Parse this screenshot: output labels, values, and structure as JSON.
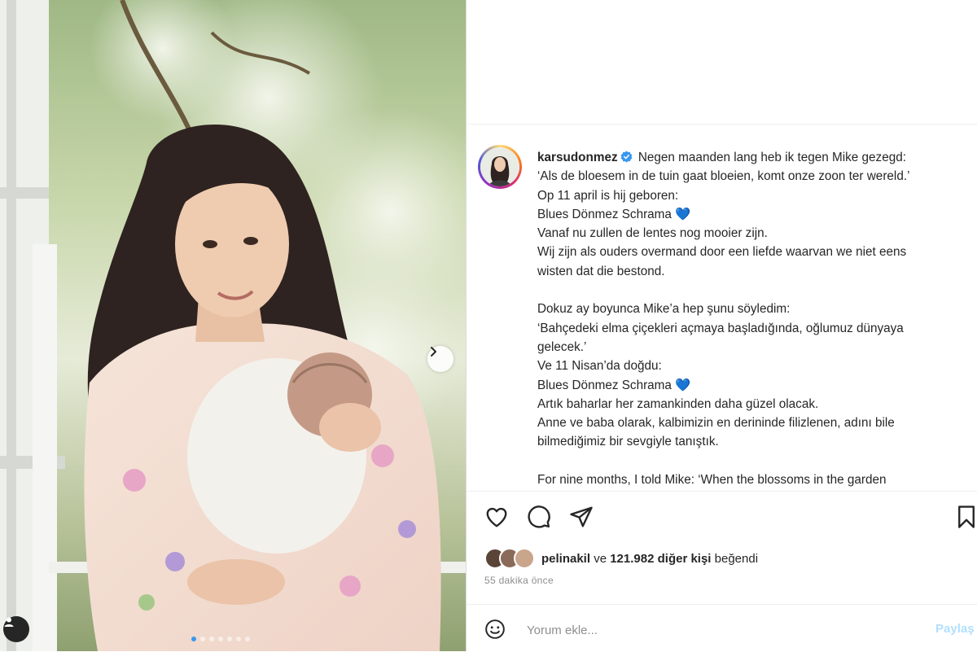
{
  "post": {
    "username": "karsudonmez",
    "caption_lines": [
      "Negen maanden lang heb ik tegen Mike gezegd:",
      "‘Als de bloesem in de tuin gaat bloeien, komt onze zoon ter wereld.’",
      "Op 11 april is hij geboren:",
      "Blues Dönmez Schrama 💙",
      "Vanaf nu zullen de lentes nog mooier zijn.",
      "Wij zijn als ouders overmand door een liefde waarvan we niet eens",
      "wisten dat die bestond.",
      "",
      "Dokuz ay boyunca Mike’a hep şunu söyledim:",
      "‘Bahçedeki elma çiçekleri açmaya başladığında, oğlumuz dünyaya",
      "gelecek.’",
      "Ve 11 Nisan’da doğdu:",
      "Blues Dönmez Schrama 💙",
      "Artık baharlar her zamankinden daha güzel olacak.",
      "Anne ve baba olarak, kalbimizin en derininde filizlenen, adını bile",
      "bilmediğimiz bir sevgiyle tanıştık.",
      "",
      "For nine months, I told Mike: ‘When the blossoms in the garden"
    ]
  },
  "likes": {
    "liker": "pelinakil",
    "connector": "ve",
    "others": "121.982 diğer kişi",
    "suffix": "beğendi"
  },
  "time_ago": "55 dakika önce",
  "comment": {
    "placeholder": "Yorum ekle...",
    "post_label": "Paylaş"
  },
  "icons": {
    "like": "heart-icon",
    "comment": "comment-icon",
    "share": "share-icon",
    "save": "bookmark-icon",
    "emoji": "emoji-icon",
    "verified": "verified-badge-icon",
    "next": "chevron-right-icon",
    "tag": "user-tag-icon"
  },
  "colors": {
    "verified": "#3897f0",
    "post_button": "#b2dffc",
    "secondary_text": "#8e8e8e"
  },
  "carousel": {
    "slide_count": 7,
    "active_index": 0
  }
}
